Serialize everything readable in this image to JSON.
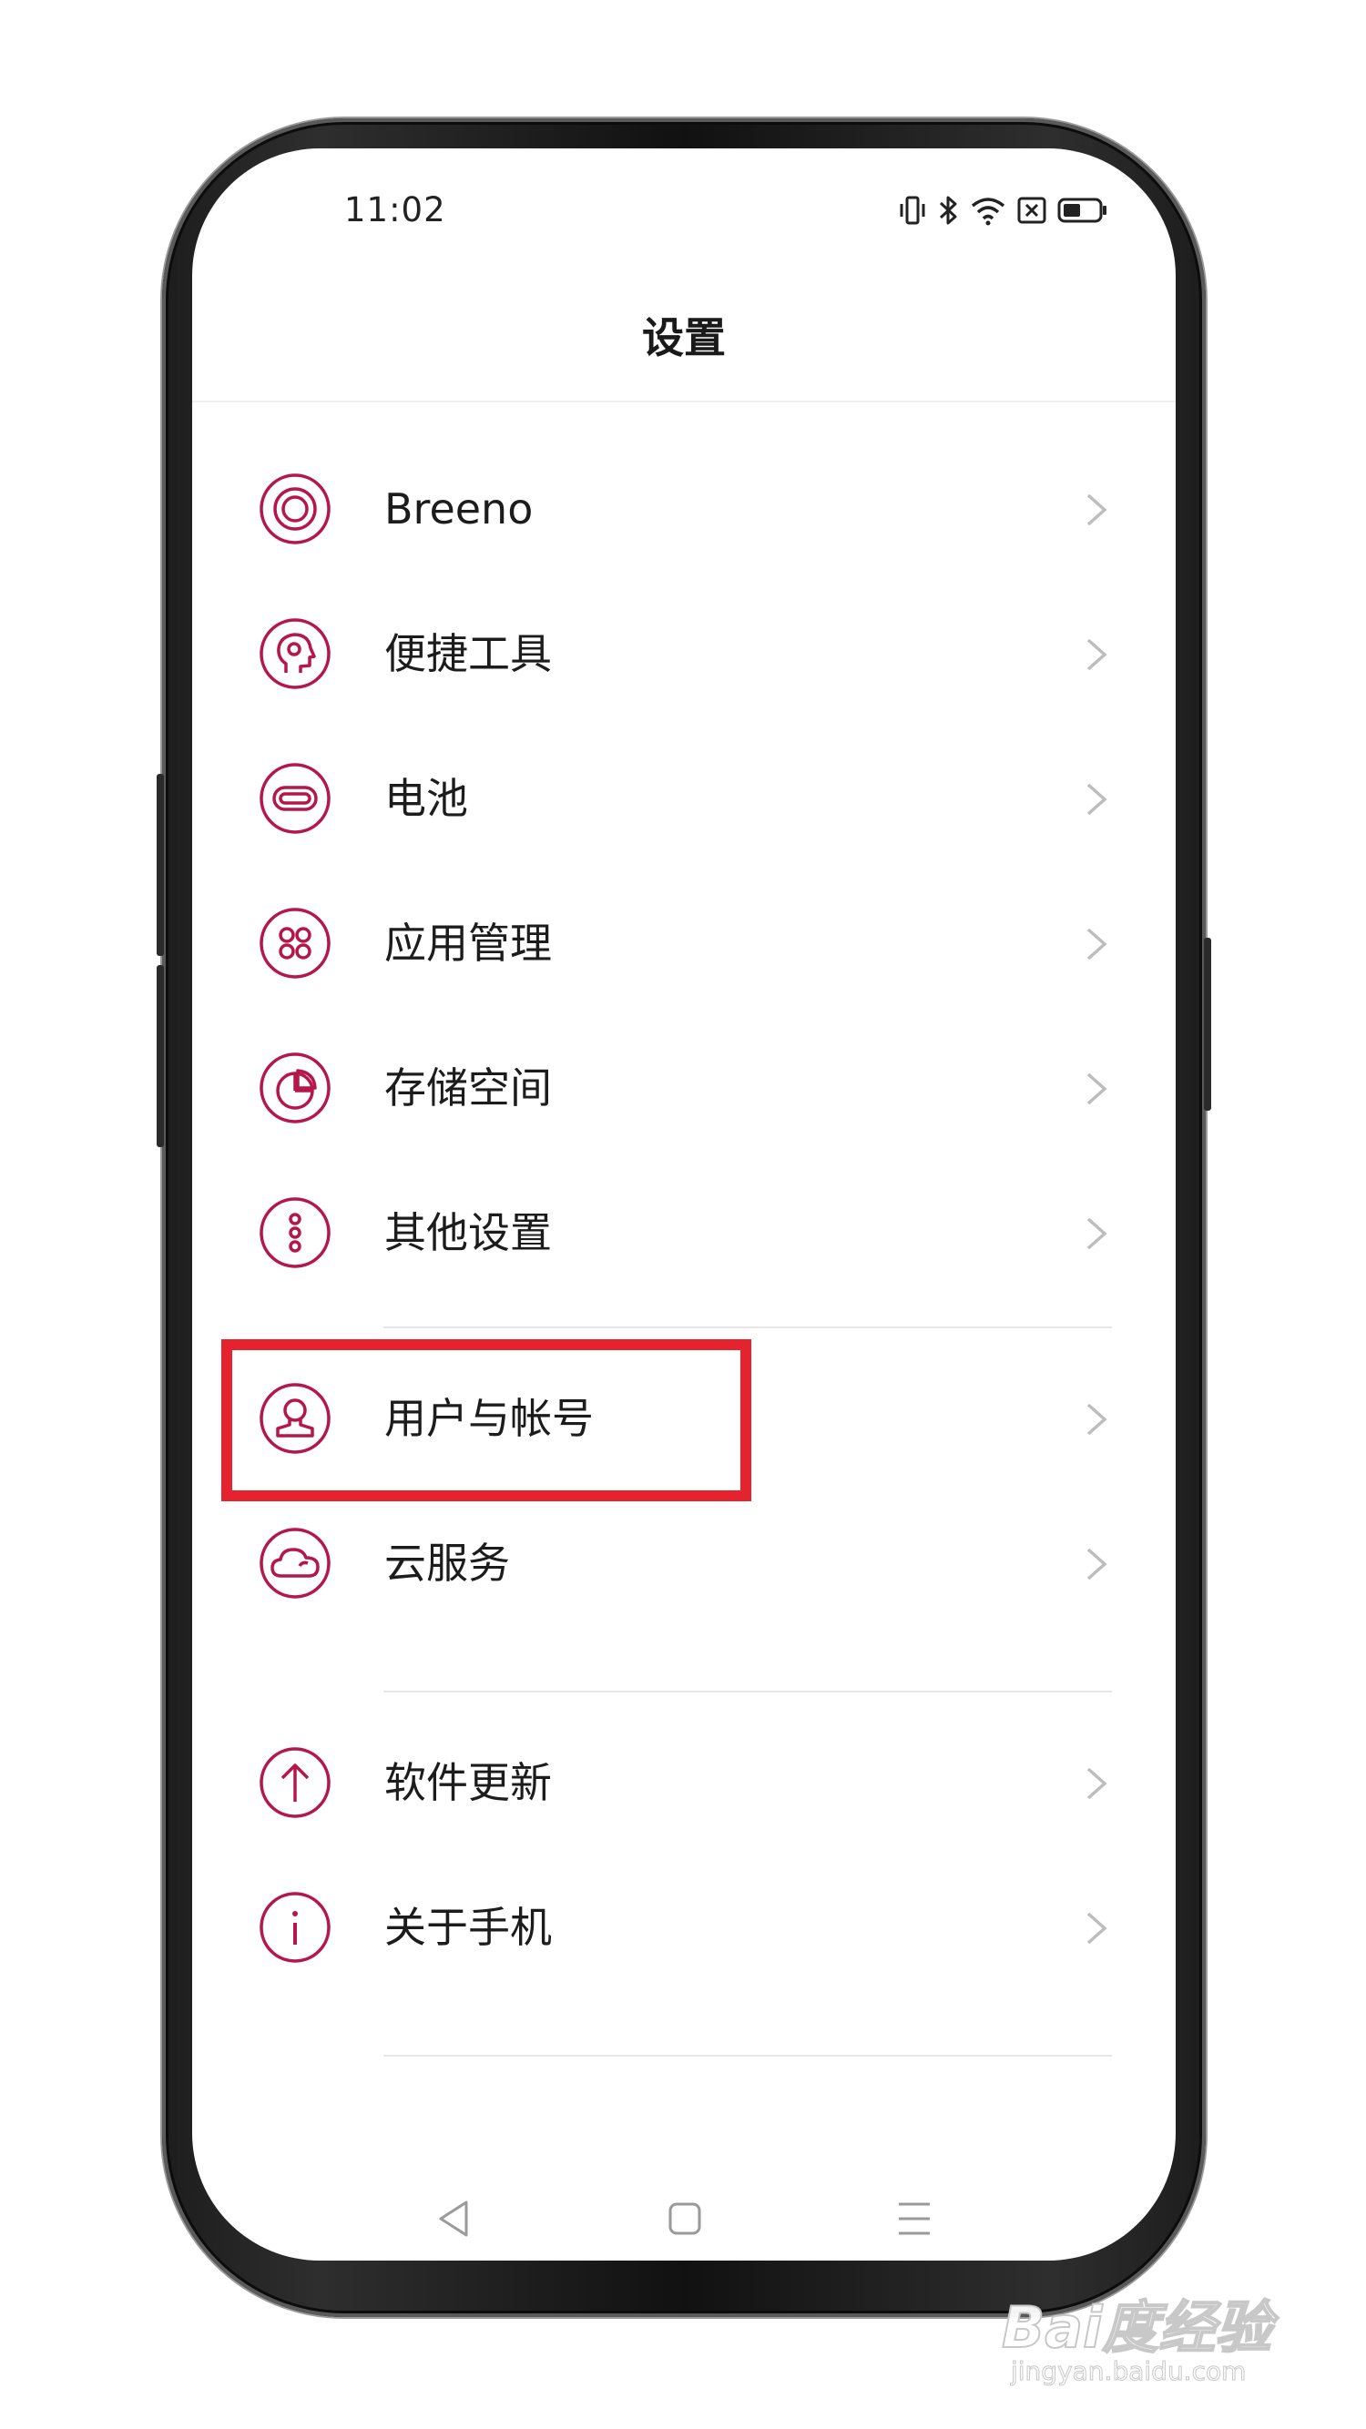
{
  "status_bar": {
    "time": "11:02",
    "icons": [
      "vibrate-icon",
      "bluetooth-icon",
      "wifi-icon",
      "no-sim-icon",
      "battery-icon"
    ]
  },
  "header": {
    "title": "设置"
  },
  "accent_color": "#b5174a",
  "highlight_color": "#e5232f",
  "groups": [
    {
      "items": [
        {
          "label": "Breeno",
          "icon": "breeno-icon"
        },
        {
          "label": "便捷工具",
          "icon": "convenience-tools-icon"
        },
        {
          "label": "电池",
          "icon": "battery-setting-icon"
        },
        {
          "label": "应用管理",
          "icon": "app-management-icon"
        },
        {
          "label": "存储空间",
          "icon": "storage-icon"
        },
        {
          "label": "其他设置",
          "icon": "more-settings-icon"
        }
      ]
    },
    {
      "items": [
        {
          "label": "用户与帐号",
          "icon": "user-account-icon",
          "highlighted": true
        },
        {
          "label": "云服务",
          "icon": "cloud-service-icon"
        }
      ]
    },
    {
      "items": [
        {
          "label": "软件更新",
          "icon": "software-update-icon"
        },
        {
          "label": "关于手机",
          "icon": "about-phone-icon"
        }
      ]
    }
  ],
  "nav_bar": {
    "icons": [
      "back-icon",
      "home-icon",
      "menu-icon"
    ]
  },
  "watermark": {
    "main": "Bai度经验",
    "sub": "jingyan.baidu.com"
  }
}
